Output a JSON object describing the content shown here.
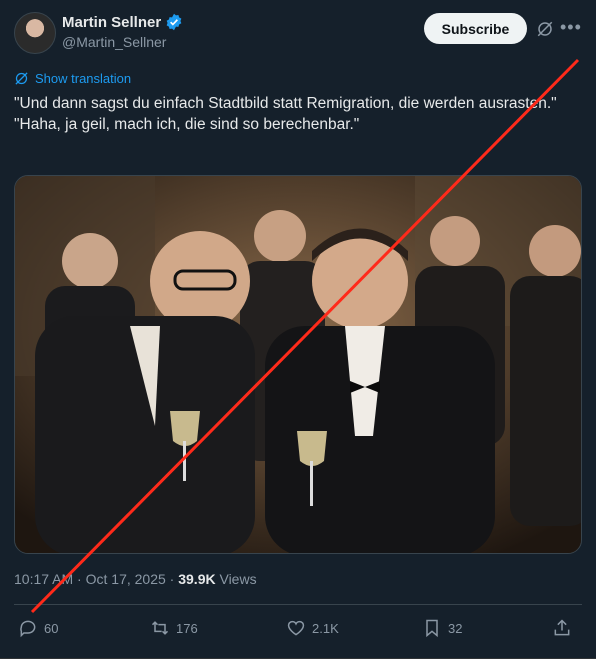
{
  "author": {
    "name": "Martin Sellner",
    "handle": "@Martin_Sellner",
    "verified": true
  },
  "header": {
    "subscribe_label": "Subscribe",
    "grok_icon": "grok-icon",
    "more_icon": "more-icon"
  },
  "translation": {
    "label": "Show translation"
  },
  "tweet": {
    "line1": "\"Und dann sagst du einfach Stadtbild statt Remigration, die werden ausrasten.\"",
    "line2": "\"Haha, ja geil, mach ich, die sind so berechenbar.\""
  },
  "meta": {
    "time": "10:17 AM",
    "date": "Oct 17, 2025",
    "separator": "·",
    "views_count": "39.9K",
    "views_label": "Views"
  },
  "actions": {
    "replies": "60",
    "reposts": "176",
    "likes": "2.1K",
    "bookmarks": "32"
  },
  "colors": {
    "background": "#15202b",
    "accent": "#1d9bf0",
    "overlay_line": "#ff2a1a"
  }
}
